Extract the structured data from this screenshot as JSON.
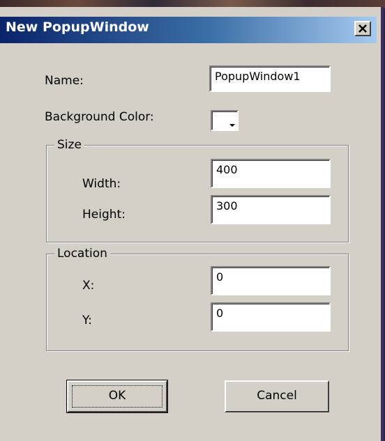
{
  "dialog": {
    "title": "New PopupWindow",
    "close_icon": "close-icon"
  },
  "form": {
    "name_label": "Name:",
    "name_value": "PopupWindow1",
    "bg_color_label": "Background Color:",
    "bg_color_value": "#ffffff"
  },
  "size_group": {
    "legend": "Size",
    "width_label": "Width:",
    "width_value": "400",
    "height_label": "Height:",
    "height_value": "300"
  },
  "location_group": {
    "legend": "Location",
    "x_label": "X:",
    "x_value": "0",
    "y_label": "Y:",
    "y_value": "0"
  },
  "buttons": {
    "ok_label": "OK",
    "cancel_label": "Cancel"
  },
  "colors": {
    "titlebar_start": "#0a246a",
    "titlebar_end": "#a6caf0",
    "dialog_face": "#d4d0c8"
  }
}
